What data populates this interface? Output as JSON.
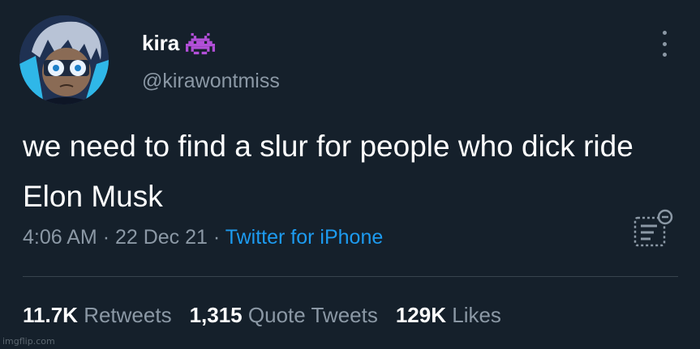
{
  "user": {
    "display_name": "kira",
    "handle": "@kirawontmiss",
    "badge_icon": "space-invader-icon"
  },
  "tweet": {
    "text": "we need to find a slur for people who dick ride Elon Musk",
    "time": "4:06 AM",
    "date": "22 Dec 21",
    "separator": "·",
    "source": "Twitter for iPhone"
  },
  "stats": {
    "retweets_count": "11.7K",
    "retweets_label": "Retweets",
    "quotes_count": "1,315",
    "quotes_label": "Quote Tweets",
    "likes_count": "129K",
    "likes_label": "Likes"
  },
  "watermark": "imgflip.com",
  "colors": {
    "background": "#15202b",
    "text_primary": "#ffffff",
    "text_secondary": "#8b98a5",
    "link": "#1d9bf0",
    "invader": "#b24fd8"
  }
}
